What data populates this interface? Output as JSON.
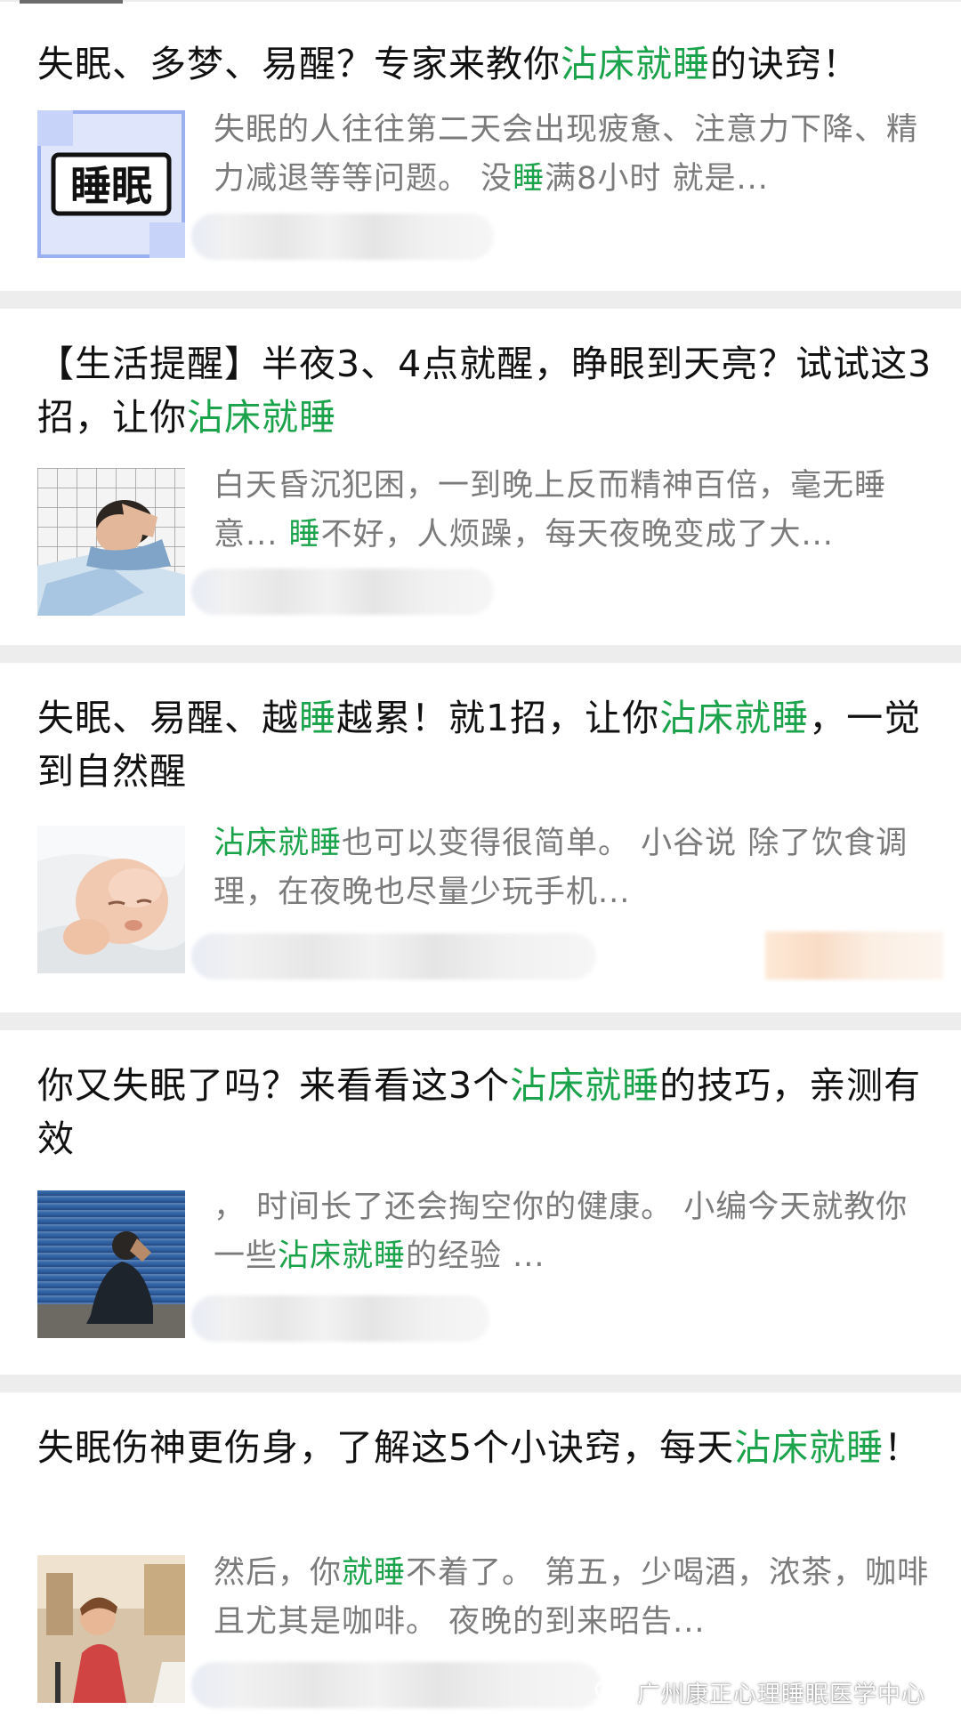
{
  "colors": {
    "highlight": "#1aa34a",
    "title": "#111111",
    "snippet": "#7b7b7b",
    "separator": "#ededed"
  },
  "articles": [
    {
      "title_parts": [
        {
          "text": "失眠、多梦、易醒？专家来教你",
          "hl": false
        },
        {
          "text": "沾床就睡",
          "hl": true
        },
        {
          "text": "的诀窍！",
          "hl": false
        }
      ],
      "snippet_parts": [
        {
          "text": "失眠的人往往第二天会出现疲惫、注意力下降、精力减退等等问题。 没",
          "hl": false
        },
        {
          "text": "睡",
          "hl": true
        },
        {
          "text": "满8小时 就是...",
          "hl": false
        }
      ],
      "thumb_text": "睡眠",
      "thumb_icon": "sleep-text-badge"
    },
    {
      "title_parts": [
        {
          "text": "【生活提醒】半夜3、4点就醒，睁眼到天亮？试试这3招，让你",
          "hl": false
        },
        {
          "text": "沾床就睡",
          "hl": true
        }
      ],
      "snippet_parts": [
        {
          "text": "白天昏沉犯困，一到晚上反而精神百倍，毫无睡意... ",
          "hl": false
        },
        {
          "text": "睡",
          "hl": true
        },
        {
          "text": "不好，人烦躁，每天夜晚变成了大...",
          "hl": false
        }
      ],
      "thumb_icon": "man-sleeping-photo"
    },
    {
      "title_parts": [
        {
          "text": "失眠、易醒、越",
          "hl": false
        },
        {
          "text": "睡",
          "hl": true
        },
        {
          "text": "越累！就1招，让你",
          "hl": false
        },
        {
          "text": "沾床就睡",
          "hl": true
        },
        {
          "text": "，一觉到自然醒",
          "hl": false
        }
      ],
      "snippet_parts": [
        {
          "text": "沾床就睡",
          "hl": true
        },
        {
          "text": "也可以变得很简单。 小谷说 除了饮食调理，在夜晚也尽量少玩手机...",
          "hl": false
        }
      ],
      "thumb_icon": "baby-sleeping-photo"
    },
    {
      "title_parts": [
        {
          "text": "你又失眠了吗？来看看这3个",
          "hl": false
        },
        {
          "text": "沾床就睡",
          "hl": true
        },
        {
          "text": "的技巧，亲测有效",
          "hl": false
        }
      ],
      "snippet_parts": [
        {
          "text": "， 时间长了还会掏空你的健康。 小编今天就教你一些",
          "hl": false
        },
        {
          "text": "沾床就睡",
          "hl": true
        },
        {
          "text": "的经验 ...",
          "hl": false
        }
      ],
      "thumb_icon": "man-insomnia-photo"
    },
    {
      "title_parts": [
        {
          "text": "失眠伤神更伤身，了解这5个小诀窍，每天",
          "hl": false
        },
        {
          "text": "沾床就睡",
          "hl": true
        },
        {
          "text": "！",
          "hl": false
        }
      ],
      "snippet_parts": [
        {
          "text": "然后，你",
          "hl": false
        },
        {
          "text": "就睡",
          "hl": true
        },
        {
          "text": "不着了。 第五，少喝酒，浓茶，咖啡且尤其是咖啡。 夜晚的到来昭告...",
          "hl": false
        }
      ],
      "thumb_icon": "woman-exercising-photo"
    }
  ],
  "watermark": {
    "icon": "wechat-icon",
    "text": "广州康正心理睡眠医学中心"
  }
}
